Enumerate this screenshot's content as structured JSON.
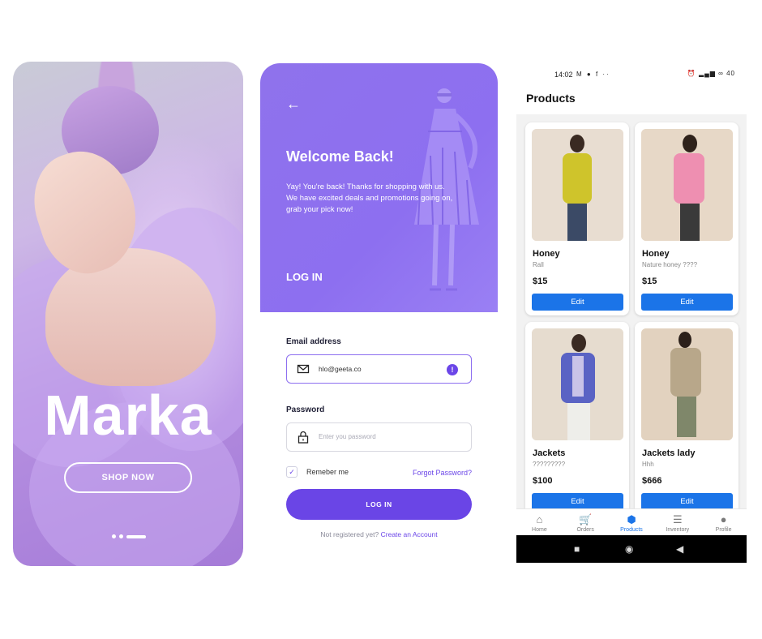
{
  "splash": {
    "brand": "Marka",
    "shop_button": "SHOP NOW",
    "pager_pages": 3,
    "pager_active": 3
  },
  "login": {
    "welcome_title": "Welcome Back!",
    "welcome_text": "Yay! You're back! Thanks for shopping with us. We have excited deals and promotions going on, grab your pick now!",
    "section_title": "LOG IN",
    "email_label": "Email address",
    "email_value": "hlo@geeta.co",
    "password_label": "Password",
    "password_placeholder": "Enter you password",
    "remember_label": "Remeber me",
    "remember_checked": true,
    "forgot_link": "Forgot Password?",
    "login_button": "LOG IN",
    "register_prompt": "Not registered yet?",
    "register_link": "Create an Account",
    "accent_color": "#6a45e6",
    "hero_color": "#8d6ff0"
  },
  "phone": {
    "status": {
      "time": "14:02",
      "left_icons": "M ● f ··",
      "right_icons": "⏰ ▂▄▆ ∞ 40"
    },
    "title": "Products",
    "products": [
      {
        "name": "Honey",
        "desc": "Rall",
        "price": "$15",
        "edit": "Edit",
        "jacket_color": "#cfc42b",
        "pants_color": "#3b4a66",
        "bg_color": "#e8ddd1"
      },
      {
        "name": "Honey",
        "desc": "Nature honey ????",
        "price": "$15",
        "edit": "Edit",
        "jacket_color": "#ee8fb1",
        "pants_color": "#3a3a3a",
        "bg_color": "#e7d8c7"
      },
      {
        "name": "Jackets",
        "desc": "?????????",
        "price": "$100",
        "edit": "Edit",
        "jacket_color": "#5a63c4",
        "pants_color": "#eeeeea",
        "bg_color": "#e6dccf"
      },
      {
        "name": "Jackets lady",
        "desc": "Hhh",
        "price": "$666",
        "edit": "Edit",
        "jacket_color": "#b8a78a",
        "pants_color": "#7f876a",
        "bg_color": "#e2d2bf"
      }
    ],
    "nav": [
      {
        "label": "Home",
        "icon": "home-icon",
        "glyph": "⌂",
        "active": false
      },
      {
        "label": "Orders",
        "icon": "cart-icon",
        "glyph": "🛒",
        "active": false
      },
      {
        "label": "Products",
        "icon": "box-icon",
        "glyph": "⬢",
        "active": true
      },
      {
        "label": "Inventory",
        "icon": "list-icon",
        "glyph": "☰",
        "active": false
      },
      {
        "label": "Profile",
        "icon": "person-icon",
        "glyph": "●",
        "active": false
      }
    ],
    "accent_color": "#1b74e8"
  }
}
